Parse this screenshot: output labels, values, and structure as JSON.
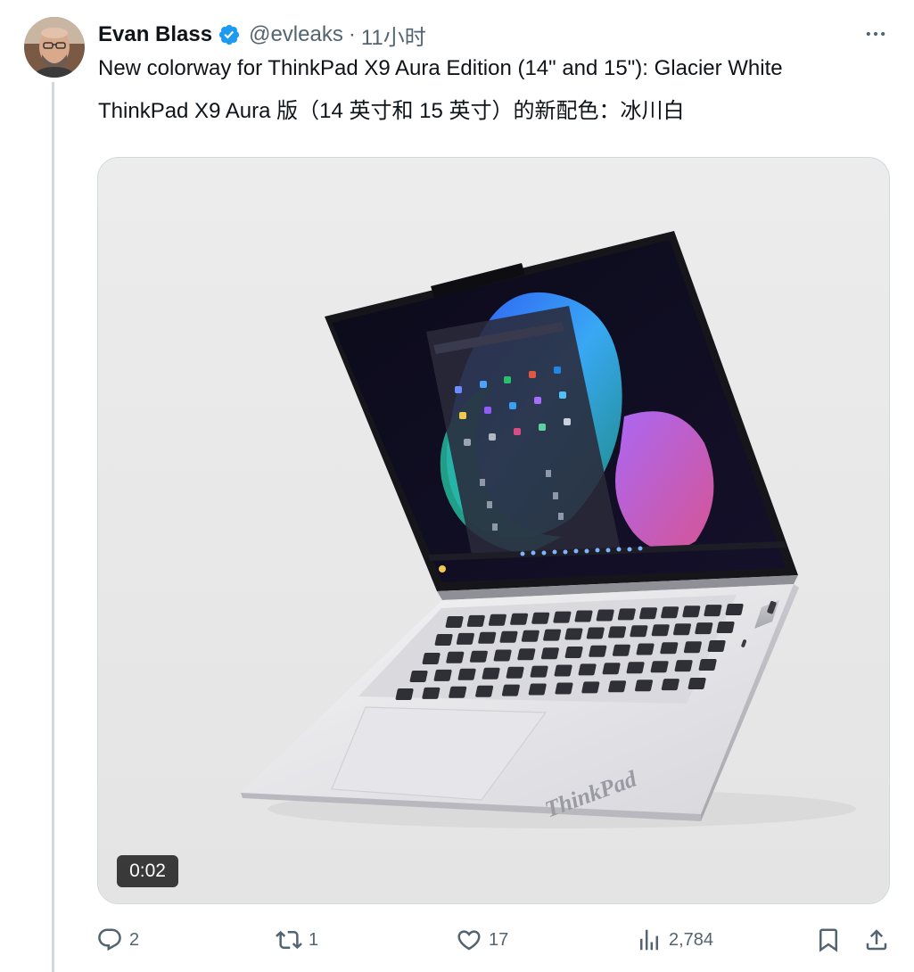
{
  "tweet": {
    "author": {
      "display_name": "Evan Blass",
      "handle": "@evleaks",
      "verified": true,
      "avatar_icon": "avatar-photo"
    },
    "separator": "·",
    "timestamp": "11小时",
    "more_icon": "more-horizontal-icon",
    "text_en": "New colorway for ThinkPad X9 Aura Edition (14\" and 15\"): Glacier White",
    "text_zh": "ThinkPad X9 Aura 版（14 英寸和 15 英寸）的新配色：冰川白",
    "media": {
      "type": "video",
      "duration": "0:02",
      "laptop_brand_mark": "ThinkPad",
      "background_color": "#e9e9e9"
    },
    "actions": {
      "reply": {
        "icon": "reply-icon",
        "count": "2"
      },
      "retweet": {
        "icon": "retweet-icon",
        "count": "1"
      },
      "like": {
        "icon": "heart-icon",
        "count": "17"
      },
      "views": {
        "icon": "views-chart-icon",
        "count": "2,784"
      },
      "bookmark": {
        "icon": "bookmark-icon"
      },
      "share": {
        "icon": "share-icon"
      }
    }
  },
  "colors": {
    "text_primary": "#0f1419",
    "text_secondary": "#536471",
    "verified_blue": "#1d9bf0",
    "border": "#cfd9de"
  }
}
